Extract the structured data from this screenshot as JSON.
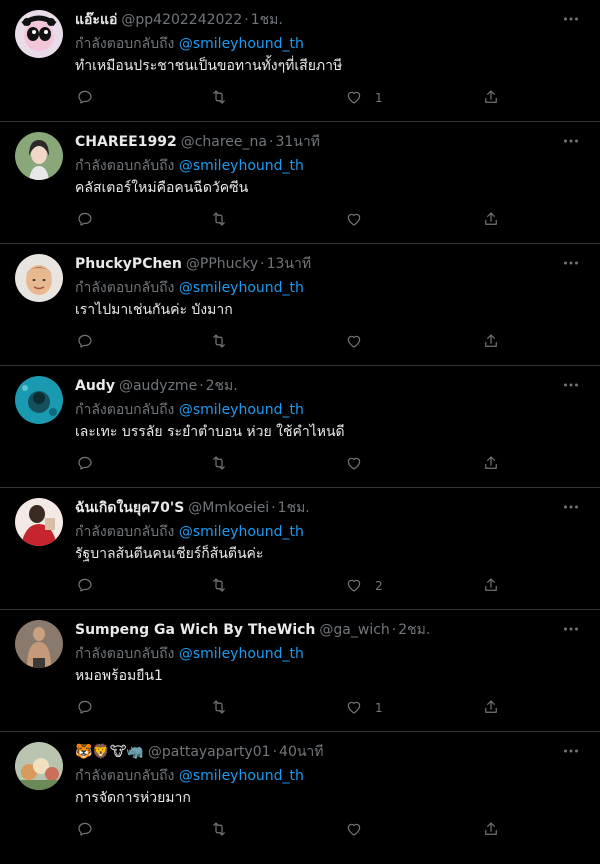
{
  "replying_prefix": "กำลังตอบกลับถึง",
  "tweets": [
    {
      "name": "แอ๊ะแอ่",
      "handle": "@pp4202242022",
      "time": "1ชม.",
      "mention": "@smileyhound_th",
      "text": "ทำเหมือนประชาชนเป็นขอทานทั้งๆที่เสียภาษี",
      "likes": "1",
      "avatar": "cartoon-girl-avatar"
    },
    {
      "name": "CHAREE1992",
      "handle": "@charee_na",
      "time": "31นาที",
      "mention": "@smileyhound_th",
      "text": "คลัสเตอร์ใหม่คือคนฉีดวัคซีน",
      "likes": "",
      "avatar": "woman-avatar"
    },
    {
      "name": "PhuckyPChen",
      "handle": "@PPhucky",
      "time": "13นาที",
      "mention": "@smileyhound_th",
      "text": "เราไปมาเช่นกันค่ะ บังมาก",
      "likes": "",
      "avatar": "man-face-avatar"
    },
    {
      "name": "Audy",
      "handle": "@audyzme",
      "time": "2ชม.",
      "mention": "@smileyhound_th",
      "text": "เละเทะ บรรลัย ระยำตำบอน ห่วย ใช้คำไหนดี",
      "likes": "",
      "avatar": "underwater-avatar"
    },
    {
      "name": "ฉันเกิดในยุค70'S",
      "handle": "@Mmkoeiei",
      "time": "1ชม.",
      "mention": "@smileyhound_th",
      "text": "รัฐบาลส้นตีนคนเชียร์ก็ส้นตีนค่ะ",
      "likes": "2",
      "avatar": "red-outfit-avatar"
    },
    {
      "name": "Sumpeng Ga Wich By TheWich",
      "handle": "@ga_wich",
      "time": "2ชม.",
      "mention": "@smileyhound_th",
      "text": "หมอพร้อมยืน1",
      "likes": "1",
      "avatar": "shirtless-man-avatar"
    },
    {
      "name": "🐯🦁🐮🦏",
      "handle": "@pattayaparty01",
      "time": "40นาที",
      "mention": "@smileyhound_th",
      "text": "การจัดการห่วยมาก",
      "likes": "",
      "avatar": "plush-toys-avatar"
    }
  ]
}
